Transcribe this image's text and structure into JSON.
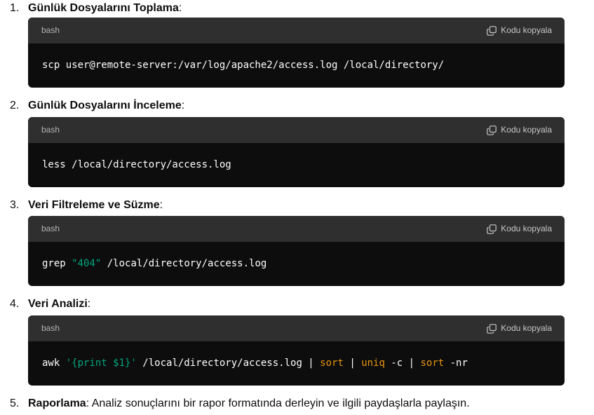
{
  "steps": [
    {
      "number": "1.",
      "title": "Günlük Dosyalarını Toplama",
      "suffix": ":",
      "language": "bash",
      "copy_label": "Kodu kopyala",
      "code": [
        {
          "text": "scp user@remote-server:/var/log/apache2/access.log /local/directory/",
          "type": "plain"
        }
      ]
    },
    {
      "number": "2.",
      "title": "Günlük Dosyalarını İnceleme",
      "suffix": ":",
      "language": "bash",
      "copy_label": "Kodu kopyala",
      "code": [
        {
          "text": "less /local/directory/access.log",
          "type": "plain"
        }
      ]
    },
    {
      "number": "3.",
      "title": "Veri Filtreleme ve Süzme",
      "suffix": ":",
      "language": "bash",
      "copy_label": "Kodu kopyala",
      "code": [
        {
          "text": "grep ",
          "type": "plain"
        },
        {
          "text": "\"404\"",
          "type": "str"
        },
        {
          "text": " /local/directory/access.log",
          "type": "plain"
        }
      ]
    },
    {
      "number": "4.",
      "title": "Veri Analizi",
      "suffix": ":",
      "language": "bash",
      "copy_label": "Kodu kopyala",
      "code": [
        {
          "text": "awk ",
          "type": "plain"
        },
        {
          "text": "'{print $1}'",
          "type": "str"
        },
        {
          "text": " /local/directory/access.log | ",
          "type": "plain"
        },
        {
          "text": "sort",
          "type": "cmd"
        },
        {
          "text": " | ",
          "type": "plain"
        },
        {
          "text": "uniq",
          "type": "cmd"
        },
        {
          "text": " -c | ",
          "type": "plain"
        },
        {
          "text": "sort",
          "type": "cmd"
        },
        {
          "text": " -nr",
          "type": "plain"
        }
      ]
    }
  ],
  "final_step": {
    "number": "5.",
    "title": "Raporlama",
    "text": ": Analiz sonuçlarını bir rapor formatında derleyin ve ilgili paydaşlarla paylaşın."
  },
  "icons": {
    "copy": "copy-icon"
  }
}
